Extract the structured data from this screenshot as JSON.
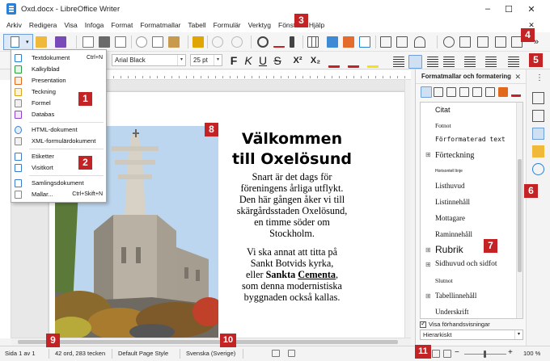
{
  "window": {
    "title": "Oxd.docx - LibreOffice Writer",
    "minimize_glyph": "–",
    "maximize_glyph": "☐",
    "close_glyph": "✕"
  },
  "menubar": {
    "items": [
      "Arkiv",
      "Redigera",
      "Visa",
      "Infoga",
      "Format",
      "Formatmallar",
      "Tabell",
      "Formulär",
      "Verktyg",
      "Fönster",
      "Hjälp"
    ],
    "close_glyph": "✕"
  },
  "formatting": {
    "paragraph_style": "",
    "font_name": "Arial Black",
    "font_size": "25 pt",
    "bold": "F",
    "italic": "K",
    "underline": "U",
    "strike": "S",
    "superscript": "X²",
    "subscript": "X₂"
  },
  "new_menu": {
    "items": [
      {
        "label": "Textdokument",
        "shortcut": "Ctrl+N",
        "icon": "writer-doc-icon",
        "color": "#2a7fd6"
      },
      {
        "label": "Kalkylblad",
        "shortcut": "",
        "icon": "calc-sheet-icon",
        "color": "#2e9e43"
      },
      {
        "label": "Presentation",
        "shortcut": "",
        "icon": "impress-icon",
        "color": "#e0691c"
      },
      {
        "label": "Teckning",
        "shortcut": "",
        "icon": "draw-icon",
        "color": "#d8a21c"
      },
      {
        "label": "Formel",
        "shortcut": "",
        "icon": "math-icon",
        "color": "#8a8a8a"
      },
      {
        "label": "Databas",
        "shortcut": "",
        "icon": "base-icon",
        "color": "#8b45c7"
      },
      {
        "label": "HTML-dokument",
        "shortcut": "",
        "icon": "html-globe-icon",
        "color": "#3b7dcc"
      },
      {
        "label": "XML-formulärdokument",
        "shortcut": "",
        "icon": "xml-form-icon",
        "color": "#888888"
      },
      {
        "label": "Etiketter",
        "shortcut": "",
        "icon": "labels-icon",
        "color": "#3b7dcc"
      },
      {
        "label": "Visitkort",
        "shortcut": "",
        "icon": "business-card-icon",
        "color": "#3b7dcc"
      },
      {
        "label": "Samlingsdokument",
        "shortcut": "",
        "icon": "master-doc-icon",
        "color": "#3b7dcc"
      },
      {
        "label": "Mallar...",
        "shortcut": "Ctrl+Skift+N",
        "icon": "templates-icon",
        "color": "#888888"
      }
    ]
  },
  "document": {
    "title_line1": "Välkommen",
    "title_line2": "till Oxelösund",
    "para1": [
      "Snart är det dags för",
      "föreningens årliga utflykt.",
      "Den här gången åker vi till",
      "skärgårdsstaden Oxelösund,",
      "en timme söder om",
      "Stockholm."
    ],
    "para2_l1": "Vi ska annat att titta på",
    "para2_l2": "Sankt Botvids kyrka,",
    "para2_l3_pre": "eller ",
    "para2_l3_b1": "Sankta",
    "para2_l3_sp": " ",
    "para2_l3_b2": "Cementa",
    "para2_l3_post": ",",
    "para2_l4": "som denna modernistiska",
    "para2_l5": "byggnaden också kallas."
  },
  "sidebar": {
    "title": "Formatmallar och formatering",
    "close_glyph": "✕",
    "styles": [
      {
        "name": "Citat",
        "expandable": false
      },
      {
        "name": "Fotnot",
        "expandable": false
      },
      {
        "name": "Förformaterad text",
        "expandable": false
      },
      {
        "name": "Förteckning",
        "expandable": true
      },
      {
        "name": "Horisontell linje",
        "expandable": false
      },
      {
        "name": "Listhuvud",
        "expandable": false
      },
      {
        "name": "Listinnehåll",
        "expandable": false
      },
      {
        "name": "Mottagare",
        "expandable": false
      },
      {
        "name": "Raminnehåll",
        "expandable": false
      },
      {
        "name": "Rubrik",
        "expandable": true
      },
      {
        "name": "Sidhuvud och sidfot",
        "expandable": true
      },
      {
        "name": "Slutnot",
        "expandable": false
      },
      {
        "name": "Tabellinnehåll",
        "expandable": true
      },
      {
        "name": "Underskrift",
        "expandable": false
      }
    ],
    "expand_glyph": "⊞",
    "preview_label": "Visa förhandsvisningar",
    "filter_value": "Hierarkiskt"
  },
  "statusbar": {
    "page": "Sida 1 av 1",
    "words": "42 ord, 283 tecken",
    "page_style": "Default Page Style",
    "language": "Svenska (Sverige)",
    "zoom": "100 %"
  },
  "badges": [
    "1",
    "2",
    "3",
    "4",
    "5",
    "6",
    "7",
    "8",
    "9",
    "10",
    "11"
  ],
  "colors": {
    "badge": "#c42326",
    "accent": "#2a7fd6"
  }
}
